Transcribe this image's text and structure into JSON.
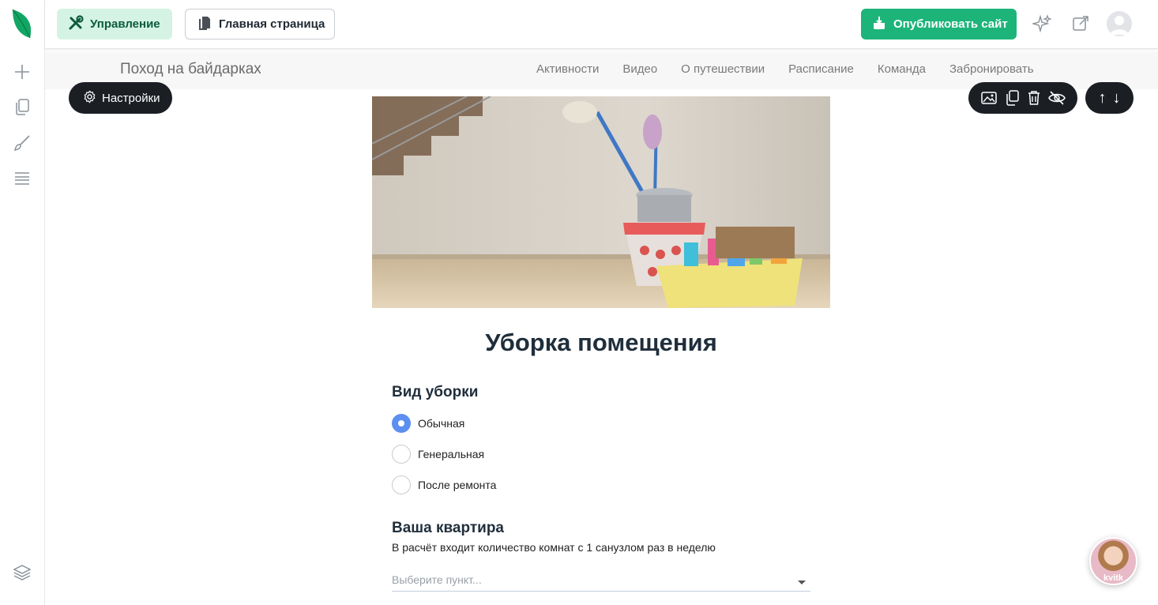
{
  "toolbar": {
    "manage_label": "Управление",
    "home_page_label": "Главная страница",
    "publish_label": "Опубликовать сайт"
  },
  "site": {
    "title": "Поход на байдарках",
    "nav": [
      "Активности",
      "Видео",
      "О путешествии",
      "Расписание",
      "Команда",
      "Забронировать"
    ]
  },
  "block": {
    "settings_label": "Настройки"
  },
  "form": {
    "heading": "Уборка помещения",
    "cleaning_type": {
      "title": "Вид уборки",
      "options": [
        "Обычная",
        "Генеральная",
        "После ремонта"
      ],
      "selected": "Обычная"
    },
    "apartment": {
      "title": "Ваша квартира",
      "description": "В расчёт входит количество комнат с 1 санузлом раз в неделю",
      "select_placeholder": "Выберите пункт..."
    }
  },
  "chat": {
    "label": "kvitk"
  },
  "colors": {
    "brand_green": "#1db47a",
    "manage_bg": "#d4f3e4",
    "dark_pill": "#1b1f24",
    "radio_selected": "#5c8ff0"
  },
  "icons": {
    "rail": [
      "leaf-logo-icon",
      "plus-icon",
      "pages-icon",
      "brush-icon",
      "sections-icon",
      "layers-icon"
    ],
    "top": [
      "sparkle-icon",
      "external-link-icon",
      "user-avatar-icon"
    ],
    "block_tools": [
      "image-icon",
      "copy-icon",
      "trash-icon",
      "eye-off-icon"
    ]
  }
}
